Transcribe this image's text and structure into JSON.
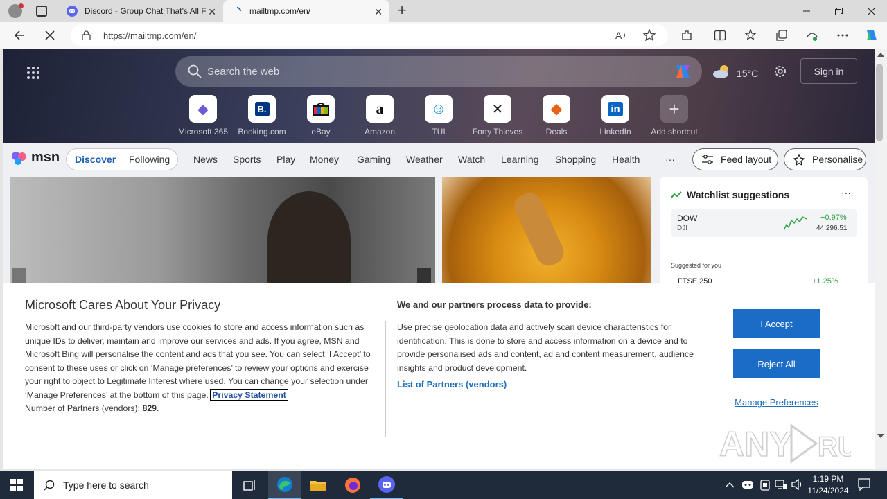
{
  "browser": {
    "tabs": [
      {
        "title": "Discord - Group Chat That’s All F",
        "favicon": "discord-icon"
      },
      {
        "title": "mailtmp.com/en/",
        "favicon": "loading-icon"
      }
    ],
    "url": "https://mailtmp.com/en/",
    "new_tab_glyph": "+",
    "close_glyph": "✕"
  },
  "newtab": {
    "search_placeholder": "Search the web",
    "weather": "15°C",
    "signin": "Sign in",
    "shortcuts": [
      {
        "label": "Microsoft 365",
        "icon": "m365-icon",
        "glyph": "◆",
        "color": "#6b5bd6"
      },
      {
        "label": "Booking.com",
        "icon": "booking-icon",
        "glyph": "B.",
        "color": "#003580"
      },
      {
        "label": "eBay",
        "icon": "ebay-icon",
        "glyph": "▣",
        "color": "#e53238"
      },
      {
        "label": "Amazon",
        "icon": "amazon-icon",
        "glyph": "a",
        "color": "#111111"
      },
      {
        "label": "TUI",
        "icon": "tui-icon",
        "glyph": "☺",
        "color": "#1a8fd6"
      },
      {
        "label": "Forty Thieves",
        "icon": "forty-thieves-icon",
        "glyph": "✕",
        "color": "#222222"
      },
      {
        "label": "Deals",
        "icon": "deals-icon",
        "glyph": "◆",
        "color": "#e8631a"
      },
      {
        "label": "LinkedIn",
        "icon": "linkedin-icon",
        "glyph": "in",
        "color": "#0a66c2"
      },
      {
        "label": "Add shortcut",
        "icon": "add-icon",
        "glyph": "+",
        "color": "#dddddd"
      }
    ],
    "brand": "msn",
    "nav_primary": [
      "Discover",
      "Following"
    ],
    "nav_links": [
      "News",
      "Sports",
      "Play",
      "Money",
      "Gaming",
      "Weather",
      "Watch",
      "Learning",
      "Shopping",
      "Health"
    ],
    "more": "···",
    "feed_layout": "Feed layout",
    "personalise": "Personalise",
    "watchlist": {
      "title": "Watchlist suggestions",
      "rows": [
        {
          "symbol": "DOW",
          "sub": "DJI",
          "change": "+0.97%",
          "price": "44,296.51"
        }
      ],
      "suggested": "Suggested for you",
      "partial_row": {
        "symbol": "FTSE 250",
        "change": "+1.25%"
      }
    }
  },
  "privacy": {
    "title": "Microsoft Cares About Your Privacy",
    "body": "Microsoft and our third-party vendors use cookies to store and access information such as unique IDs to deliver, maintain and improve our services and ads. If you agree, MSN and Microsoft Bing will personalise the content and ads that you see. You can select ‘I Accept’ to consent to these uses or click on ‘Manage preferences’ to review your options and exercise your right to object to Legitimate Interest where used.  You can change your selection under ‘Manage Preferences’ at the bottom of this page.",
    "privacy_link": "Privacy Statement",
    "partners_prefix": "Number of Partners (vendors): ",
    "partners_count": "829",
    "col2_title": "We and our partners process data to provide:",
    "col2_body": "Use precise geolocation data and actively scan device characteristics for identification. This is done to store and access information on a device and to provide personalised ads and content, ad and content measurement, audience insights and product development.",
    "partners_link": "List of Partners (vendors)",
    "accept": "I Accept",
    "reject": "Reject All",
    "manage": "Manage Preferences"
  },
  "watermark": "ANY RUN",
  "taskbar": {
    "search_placeholder": "Type here to search",
    "time": "1:19 PM",
    "date": "11/24/2024"
  }
}
